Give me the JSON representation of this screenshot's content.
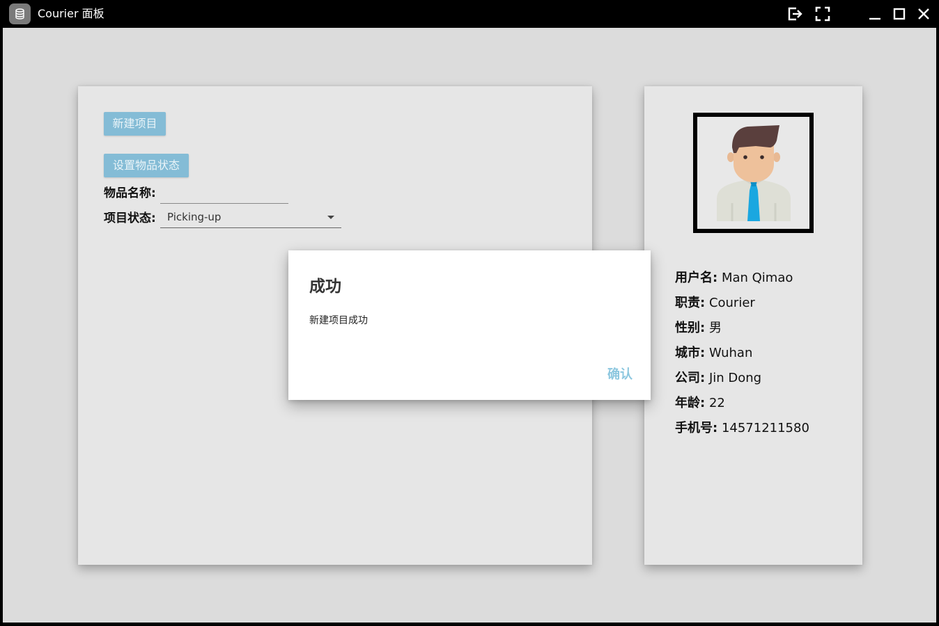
{
  "window": {
    "title": "Courier 面板"
  },
  "actions": {
    "new_project_label": "新建项目",
    "set_status_label": "设置物品状态"
  },
  "form": {
    "item_name_label": "物品名称:",
    "item_name_value": "",
    "project_status_label": "项目状态:",
    "project_status_value": "Picking-up"
  },
  "profile": {
    "rows": [
      {
        "label": "用户名:",
        "value": "Man Qimao"
      },
      {
        "label": "职责:",
        "value": "Courier"
      },
      {
        "label": "性别:",
        "value": "男"
      },
      {
        "label": "城市:",
        "value": "Wuhan"
      },
      {
        "label": "公司:",
        "value": "Jin Dong"
      },
      {
        "label": "年龄:",
        "value": "22"
      },
      {
        "label": "手机号:",
        "value": "14571211580"
      }
    ]
  },
  "dialog": {
    "title": "成功",
    "message": "新建项目成功",
    "confirm_label": "确认"
  },
  "colors": {
    "button_bg": "#84bcd6",
    "confirm_text": "#8cc7df",
    "card_bg": "#e6e6e6",
    "tie": "#1aa7e0"
  }
}
